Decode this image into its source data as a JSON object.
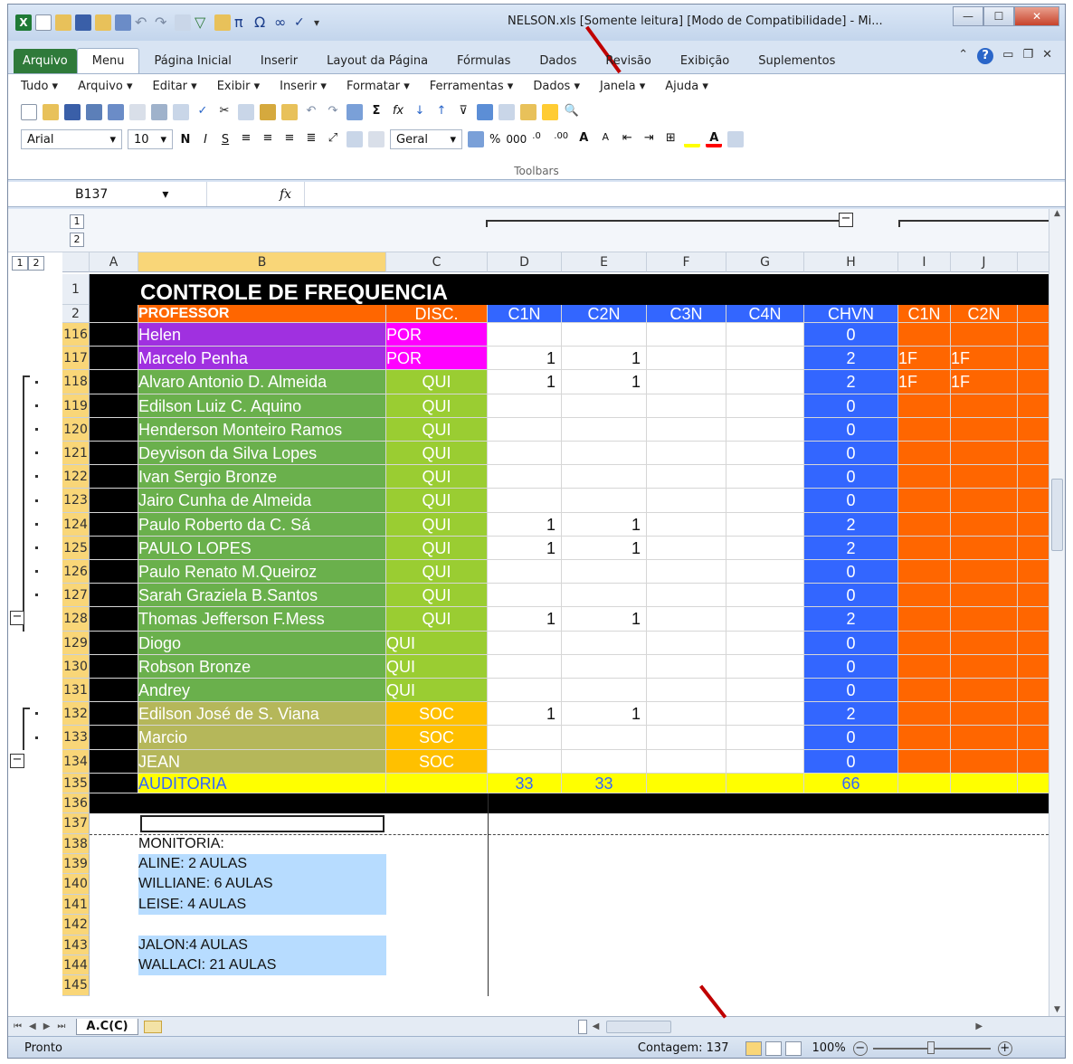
{
  "window": {
    "title": "NELSON.xls [Somente leitura] [Modo de Compatibilidade] - Mi..."
  },
  "ribbon": {
    "tabs": [
      "Arquivo",
      "Menu",
      "Página Inicial",
      "Inserir",
      "Layout da Página",
      "Fórmulas",
      "Dados",
      "Revisão",
      "Exibição",
      "Suplementos"
    ],
    "menubar": [
      "Tudo",
      "Arquivo",
      "Editar",
      "Exibir",
      "Inserir",
      "Formatar",
      "Ferramentas",
      "Dados",
      "Janela",
      "Ajuda"
    ],
    "font_name": "Arial",
    "font_size": "10",
    "number_format": "Geral",
    "bold": "N",
    "italic": "I",
    "underline": "S",
    "percent": "%",
    "thousands": "000",
    "toolbars_label": "Toolbars"
  },
  "formula_bar": {
    "name_box": "B137",
    "fx": "fx"
  },
  "outline_levels": [
    "1",
    "2"
  ],
  "columns": [
    "A",
    "B",
    "C",
    "D",
    "E",
    "F",
    "G",
    "H",
    "I",
    "J"
  ],
  "sheet": {
    "title": "CONTROLE DE FREQUENCIA",
    "header": {
      "professor": "PROFESSOR",
      "disc": "DISC.",
      "c1n": "C1N",
      "c2n": "C2N",
      "c3n": "C3N",
      "c4n": "C4N",
      "chvn": "CHVN",
      "i": "C1N",
      "j": "C2N"
    },
    "rows": [
      {
        "n": "116",
        "name": "Helen",
        "disc": "POR",
        "d": "",
        "e": "",
        "h": "0",
        "i": "",
        "j": ""
      },
      {
        "n": "117",
        "name": "Marcelo Penha",
        "disc": "POR",
        "d": "1",
        "e": "1",
        "h": "2",
        "i": "1F",
        "j": "1F"
      },
      {
        "n": "118",
        "name": "Alvaro Antonio D. Almeida",
        "disc": "QUI",
        "d": "1",
        "e": "1",
        "h": "2",
        "i": "1F",
        "j": "1F"
      },
      {
        "n": "119",
        "name": "Edilson Luiz C. Aquino",
        "disc": "QUI",
        "d": "",
        "e": "",
        "h": "0",
        "i": "",
        "j": ""
      },
      {
        "n": "120",
        "name": "Henderson Monteiro Ramos",
        "disc": "QUI",
        "d": "",
        "e": "",
        "h": "0",
        "i": "",
        "j": ""
      },
      {
        "n": "121",
        "name": "Deyvison da Silva Lopes",
        "disc": "QUI",
        "d": "",
        "e": "",
        "h": "0",
        "i": "",
        "j": ""
      },
      {
        "n": "122",
        "name": "Ivan Sergio Bronze",
        "disc": "QUI",
        "d": "",
        "e": "",
        "h": "0",
        "i": "",
        "j": ""
      },
      {
        "n": "123",
        "name": "Jairo Cunha de Almeida",
        "disc": "QUI",
        "d": "",
        "e": "",
        "h": "0",
        "i": "",
        "j": ""
      },
      {
        "n": "124",
        "name": "Paulo Roberto da C. Sá",
        "disc": "QUI",
        "d": "1",
        "e": "1",
        "h": "2",
        "i": "",
        "j": ""
      },
      {
        "n": "125",
        "name": "PAULO LOPES",
        "disc": "QUI",
        "d": "1",
        "e": "1",
        "h": "2",
        "i": "",
        "j": ""
      },
      {
        "n": "126",
        "name": "Paulo Renato M.Queiroz",
        "disc": "QUI",
        "d": "",
        "e": "",
        "h": "0",
        "i": "",
        "j": ""
      },
      {
        "n": "127",
        "name": "Sarah Graziela B.Santos",
        "disc": "QUI",
        "d": "",
        "e": "",
        "h": "0",
        "i": "",
        "j": ""
      },
      {
        "n": "128",
        "name": "Thomas Jefferson F.Mess",
        "disc": "QUI",
        "d": "1",
        "e": "1",
        "h": "2",
        "i": "",
        "j": ""
      },
      {
        "n": "129",
        "name": "Diogo",
        "disc": "QUI",
        "d": "",
        "e": "",
        "h": "0",
        "i": "",
        "j": ""
      },
      {
        "n": "130",
        "name": "Robson Bronze",
        "disc": "QUI",
        "d": "",
        "e": "",
        "h": "0",
        "i": "",
        "j": ""
      },
      {
        "n": "131",
        "name": "Andrey",
        "disc": "QUI",
        "d": "",
        "e": "",
        "h": "0",
        "i": "",
        "j": ""
      },
      {
        "n": "132",
        "name": "Edilson José de S. Viana",
        "disc": "SOC",
        "d": "1",
        "e": "1",
        "h": "2",
        "i": "",
        "j": ""
      },
      {
        "n": "133",
        "name": "Marcio",
        "disc": "SOC",
        "d": "",
        "e": "",
        "h": "0",
        "i": "",
        "j": ""
      },
      {
        "n": "134",
        "name": "JEAN",
        "disc": "SOC",
        "d": "",
        "e": "",
        "h": "0",
        "i": "",
        "j": ""
      }
    ],
    "total": {
      "n": "135",
      "label": "AUDITORIA",
      "d": "33",
      "e": "33",
      "h": "66"
    },
    "extra_rows": [
      "136",
      "137",
      "138",
      "139",
      "140",
      "141",
      "142",
      "143",
      "144",
      "145"
    ],
    "monitoria": {
      "label": "MONITORIA:",
      "lines": [
        "ALINE: 2 AULAS",
        "WILLIANE: 6 AULAS",
        "LEISE: 4 AULAS",
        "",
        "JALON:4 AULAS",
        "WALLACI: 21 AULAS"
      ]
    }
  },
  "sheet_tab": "A.C(C)",
  "status": {
    "ready": "Pronto",
    "count": "Contagem: 137",
    "zoom": "100%"
  },
  "colors": {
    "purple": "#a030e0",
    "magenta": "#ff00ff",
    "green": "#6ab04c",
    "lime": "#9acd32",
    "olive": "#b5b75a",
    "gold": "#ffc000",
    "blue": "#3366ff",
    "orange": "#ff6600",
    "yellow": "#ffff00",
    "black": "#000000",
    "lightblue": "#b7dcff"
  }
}
